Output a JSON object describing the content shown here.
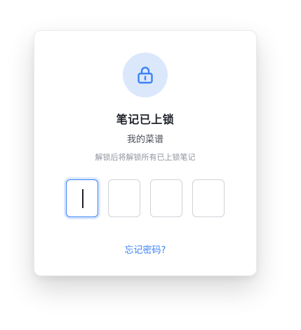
{
  "lock_screen": {
    "icon": "lock-icon",
    "title": "笔记已上锁",
    "subtitle": "我的菜谱",
    "hint": "解锁后将解锁所有已上锁笔记",
    "pin": {
      "length": 4,
      "entered": 0,
      "active_index": 0
    },
    "forgot_label": "忘记密码?"
  },
  "colors": {
    "accent": "#3b82f6",
    "icon_bg": "#dbe8fb",
    "title": "#1f2329",
    "hint": "#8f959e"
  }
}
